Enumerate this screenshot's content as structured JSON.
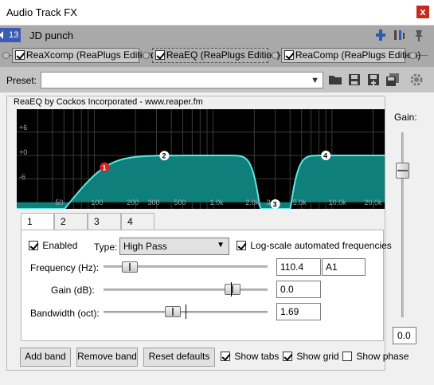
{
  "window": {
    "title": "Audio Track FX",
    "close_label": "x"
  },
  "track": {
    "number": "13",
    "name": "JD punch"
  },
  "chain": [
    {
      "label": "ReaXcomp (ReaPlugs Edition)",
      "enabled": true
    },
    {
      "label": "ReaEQ (ReaPlugs Edition)",
      "enabled": true,
      "selected": true
    },
    {
      "label": "ReaComp (ReaPlugs Edition)",
      "enabled": true
    }
  ],
  "preset": {
    "label": "Preset:",
    "value": "",
    "arrow": "▼"
  },
  "plugin": {
    "title": "ReaEQ by Cockos Incorporated - www.reaper.fm",
    "graph": {
      "y_labels": [
        "+6",
        "+0",
        "-6"
      ],
      "x_labels": [
        "50",
        "100",
        "200",
        "300",
        "500",
        "1.0k",
        "2.0k",
        "3.0k",
        "5.0k",
        "10.0k",
        "20.0k"
      ],
      "band_markers": [
        "1",
        "2",
        "3",
        "4"
      ],
      "colors": {
        "background": "#000000",
        "fill": "#0f7f7b",
        "curve": "#5fe6e0",
        "grid": "#3a3a3a",
        "band_selected": "#e02020",
        "band": "#ffffff"
      }
    },
    "tabs": [
      "1",
      "2",
      "3",
      "4"
    ],
    "active_tab": "1",
    "band": {
      "enabled_label": "Enabled",
      "enabled": true,
      "type_label": "Type:",
      "type_value": "High Pass",
      "logscale_label": "Log-scale automated frequencies",
      "logscale": true,
      "frequency_label": "Frequency (Hz):",
      "frequency_value": "110.4",
      "note_value": "A1",
      "gain_label": "Gain (dB):",
      "gain_value": "0.0",
      "bandwidth_label": "Bandwidth (oct):",
      "bandwidth_value": "1.69"
    },
    "buttons": {
      "add": "Add band",
      "remove": "Remove band",
      "reset": "Reset defaults"
    },
    "options": {
      "show_tabs": {
        "label": "Show tabs",
        "checked": true
      },
      "show_grid": {
        "label": "Show grid",
        "checked": true
      },
      "show_phase": {
        "label": "Show phase",
        "checked": false
      }
    },
    "gain": {
      "label": "Gain:",
      "value": "0.0"
    }
  }
}
